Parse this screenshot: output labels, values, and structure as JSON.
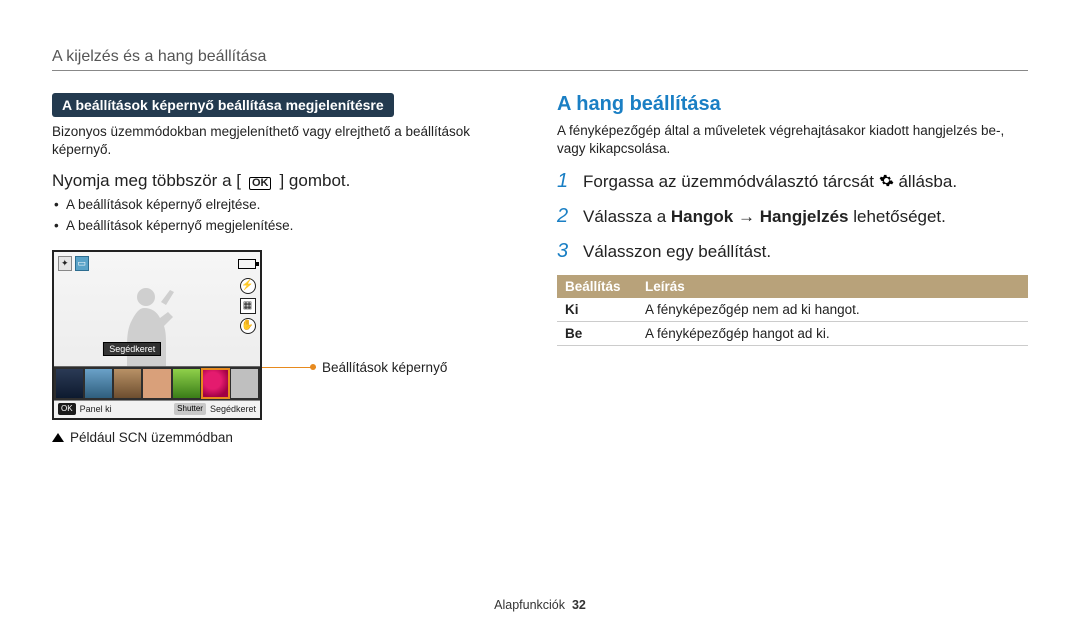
{
  "header": {
    "title": "A kijelzés és a hang beállítása"
  },
  "left": {
    "pill": "A beállítások képernyő beállítása megjelenítésre",
    "intro": "Bizonyos üzemmódokban megjeleníthető vagy elrejthető a beállítások képernyő.",
    "step_prefix": "Nyomja meg többször a [",
    "ok_label": "OK",
    "step_suffix": "] gombot.",
    "bullets": [
      "A beállítások képernyő elrejtése.",
      "A beállítások képernyő megjelenítése."
    ],
    "lcd": {
      "badge": "Segédkeret",
      "footer_ok": "OK",
      "footer_panel": "Panel ki",
      "footer_shutter": "Shutter",
      "footer_seged": "Segédkeret"
    },
    "leader_label": "Beállítások képernyő",
    "caption": "Például SCN üzemmódban"
  },
  "right": {
    "heading": "A hang beállítása",
    "intro": "A fényképezőgép által a műveletek végrehajtásakor kiadott hangjelzés be-, vagy kikapcsolása.",
    "steps": [
      {
        "num": "1",
        "prefix": "Forgassa az üzemmódválasztó tárcsát ",
        "gear": true,
        "suffix": " állásba."
      },
      {
        "num": "2",
        "plain_pre": "Válassza a ",
        "bold1": "Hangok",
        "arrow": " → ",
        "bold2": "Hangjelzés",
        "plain_post": " lehetőséget."
      },
      {
        "num": "3",
        "plain": "Válasszon egy beállítást."
      }
    ],
    "table": {
      "head": [
        "Beállítás",
        "Leírás"
      ],
      "rows": [
        [
          "Ki",
          "A fényképezőgép nem ad ki hangot."
        ],
        [
          "Be",
          "A fényképezőgép hangot ad ki."
        ]
      ]
    }
  },
  "footer": {
    "section": "Alapfunkciók",
    "page": "32"
  }
}
